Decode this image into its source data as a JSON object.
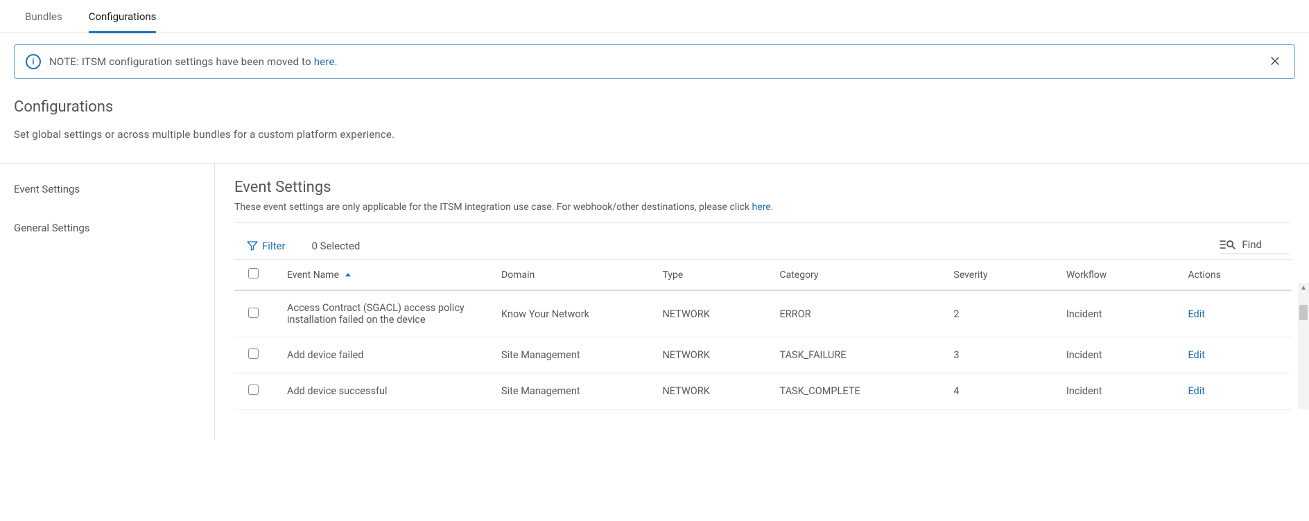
{
  "tabs": {
    "bundles": "Bundles",
    "configurations": "Configurations"
  },
  "notice": {
    "prefix": "NOTE: ITSM configuration settings have been moved to ",
    "link": "here."
  },
  "page": {
    "title": "Configurations",
    "subtitle": "Set global settings or across multiple bundles for a custom platform experience."
  },
  "sidebar": {
    "event_settings": "Event Settings",
    "general_settings": "General Settings"
  },
  "section": {
    "title": "Event Settings",
    "sub_prefix": "These event settings are only applicable for the ITSM integration use case. For webhook/other destinations, please click ",
    "sub_link": "here",
    "sub_suffix": "."
  },
  "toolbar": {
    "filter": "Filter",
    "selected": "0 Selected",
    "find": "Find"
  },
  "columns": {
    "event_name": "Event Name",
    "domain": "Domain",
    "type": "Type",
    "category": "Category",
    "severity": "Severity",
    "workflow": "Workflow",
    "actions": "Actions"
  },
  "action_label": "Edit",
  "rows": [
    {
      "name": "Access Contract (SGACL) access policy installation failed on the device",
      "domain": "Know Your Network",
      "type": "NETWORK",
      "category": "ERROR",
      "severity": "2",
      "workflow": "Incident"
    },
    {
      "name": "Add device failed",
      "domain": "Site Management",
      "type": "NETWORK",
      "category": "TASK_FAILURE",
      "severity": "3",
      "workflow": "Incident"
    },
    {
      "name": "Add device successful",
      "domain": "Site Management",
      "type": "NETWORK",
      "category": "TASK_COMPLETE",
      "severity": "4",
      "workflow": "Incident"
    }
  ]
}
